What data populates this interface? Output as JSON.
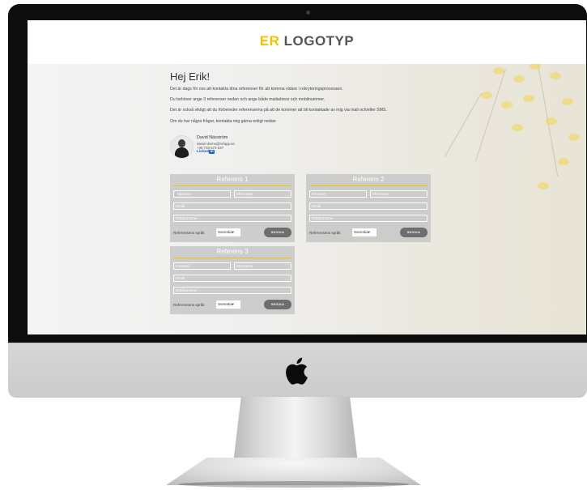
{
  "header": {
    "logo_accent": "ER",
    "logo_text": "LOGOTYP"
  },
  "intro": {
    "greeting": "Hej Erik!",
    "paragraphs": [
      "Det är dags för oss att kontakta dina referenser för att komma vidare i rekryteringsprocessen.",
      "Du behöver ange 3 referenser nedan och ange både mailadress och mobilnummer.",
      "Det är också viktigt att du förbereder referenserna på att de kommer att bli kontaktade av mig via mail och/eller SMS.",
      "Om du har några frågor, kontakta mig gärna enligt nedan"
    ]
  },
  "contact": {
    "name": "David Näsström",
    "email": "david+demo@refapp.se",
    "phone": "+46 733 573 627",
    "linkedin_label": "Linked",
    "linkedin_badge": "in"
  },
  "references": [
    {
      "title": "Referens 1",
      "firstname_placeholder": "Förnamn",
      "lastname_placeholder": "Efternamn",
      "email_placeholder": "Email",
      "mobile_placeholder": "Mobilnummer",
      "language_label": "Referensens språk",
      "language_value": "Svenska▾",
      "send_label": "SKICKA"
    },
    {
      "title": "Referens 2",
      "firstname_placeholder": "Förnamn",
      "lastname_placeholder": "Efternamn",
      "email_placeholder": "Email",
      "mobile_placeholder": "Mobilnummer",
      "language_label": "Referensens språk",
      "language_value": "Svenska▾",
      "send_label": "SKICKA"
    },
    {
      "title": "Referens 3",
      "firstname_placeholder": "Förnamn",
      "lastname_placeholder": "Efternamn",
      "email_placeholder": "Email",
      "mobile_placeholder": "Mobilnummer",
      "language_label": "Referensens språk",
      "language_value": "Svenska▾",
      "send_label": "SKICKA"
    }
  ],
  "colors": {
    "accent": "#f2c200",
    "card_bg": "#c4c4c4",
    "button": "#6e6e6e",
    "linkedin": "#1a62b5"
  },
  "icons": {
    "apple_logo": "apple-logo-icon",
    "avatar": "person-avatar"
  }
}
